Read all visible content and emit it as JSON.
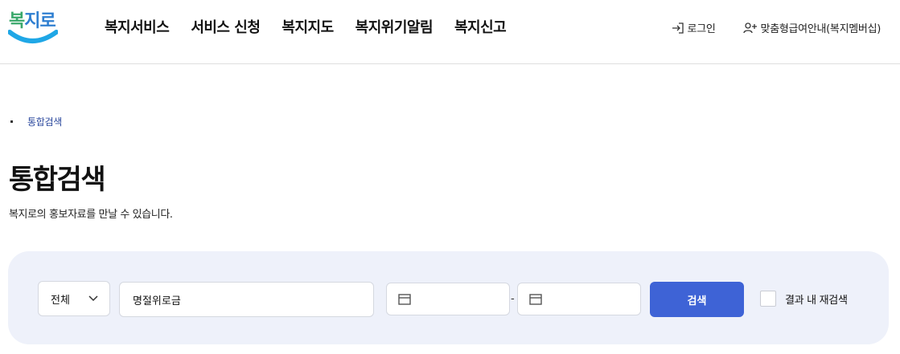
{
  "header": {
    "logo_text": [
      "복",
      "지",
      "로"
    ],
    "nav": [
      "복지서비스",
      "서비스 신청",
      "복지지도",
      "복지위기알림",
      "복지신고"
    ],
    "login_label": "로그인",
    "member_label": "맞춤형급여안내(복지멤버십)"
  },
  "breadcrumb": {
    "current": "통합검색"
  },
  "page": {
    "title": "통합검색",
    "description": "복지로의 홍보자료를 만날 수 있습니다."
  },
  "search": {
    "category_selected": "전체",
    "keyword_value": "명절위로금",
    "date_separator": "-",
    "submit_label": "검색",
    "research_label": "결과 내 재검색"
  },
  "colors": {
    "primary_button": "#3e63d6",
    "panel_bg": "#eef1fa",
    "breadcrumb_link": "#2d4a9e"
  }
}
